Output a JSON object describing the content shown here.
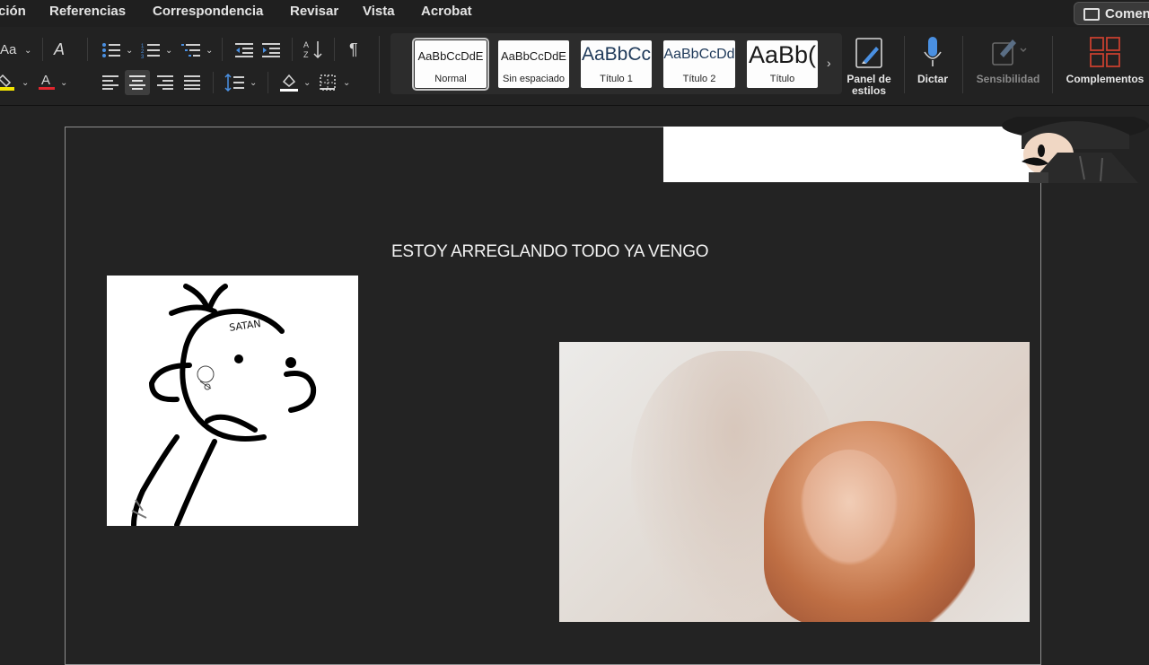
{
  "menu": {
    "items": [
      "ción",
      "Referencias",
      "Correspondencia",
      "Revisar",
      "Vista",
      "Acrobat"
    ],
    "comments_label": "Comen"
  },
  "ribbon": {
    "font_size_label": "Aa",
    "styles": [
      {
        "preview": "AaBbCcDdE",
        "caption": "Normal"
      },
      {
        "preview": "AaBbCcDdE",
        "caption": "Sin espaciado"
      },
      {
        "preview": "AaBbCc",
        "caption": "Título 1"
      },
      {
        "preview": "AaBbCcDd",
        "caption": "Título 2"
      },
      {
        "preview": "AaBb(",
        "caption": "Título"
      }
    ],
    "styles_panel_label": "Panel de estilos",
    "dictate_label": "Dictar",
    "sensitivity_label": "Sensibilidad",
    "addins_label": "Complementos",
    "colors": {
      "highlight": "#f2e400",
      "font_color": "#e0262e",
      "addins_icon": "#c6402f",
      "dictate_icon": "#4a90e2"
    }
  },
  "document": {
    "heading": "ESTOY ARREGLANDO TODO YA VENGO",
    "drawing_text": "SATAN"
  }
}
